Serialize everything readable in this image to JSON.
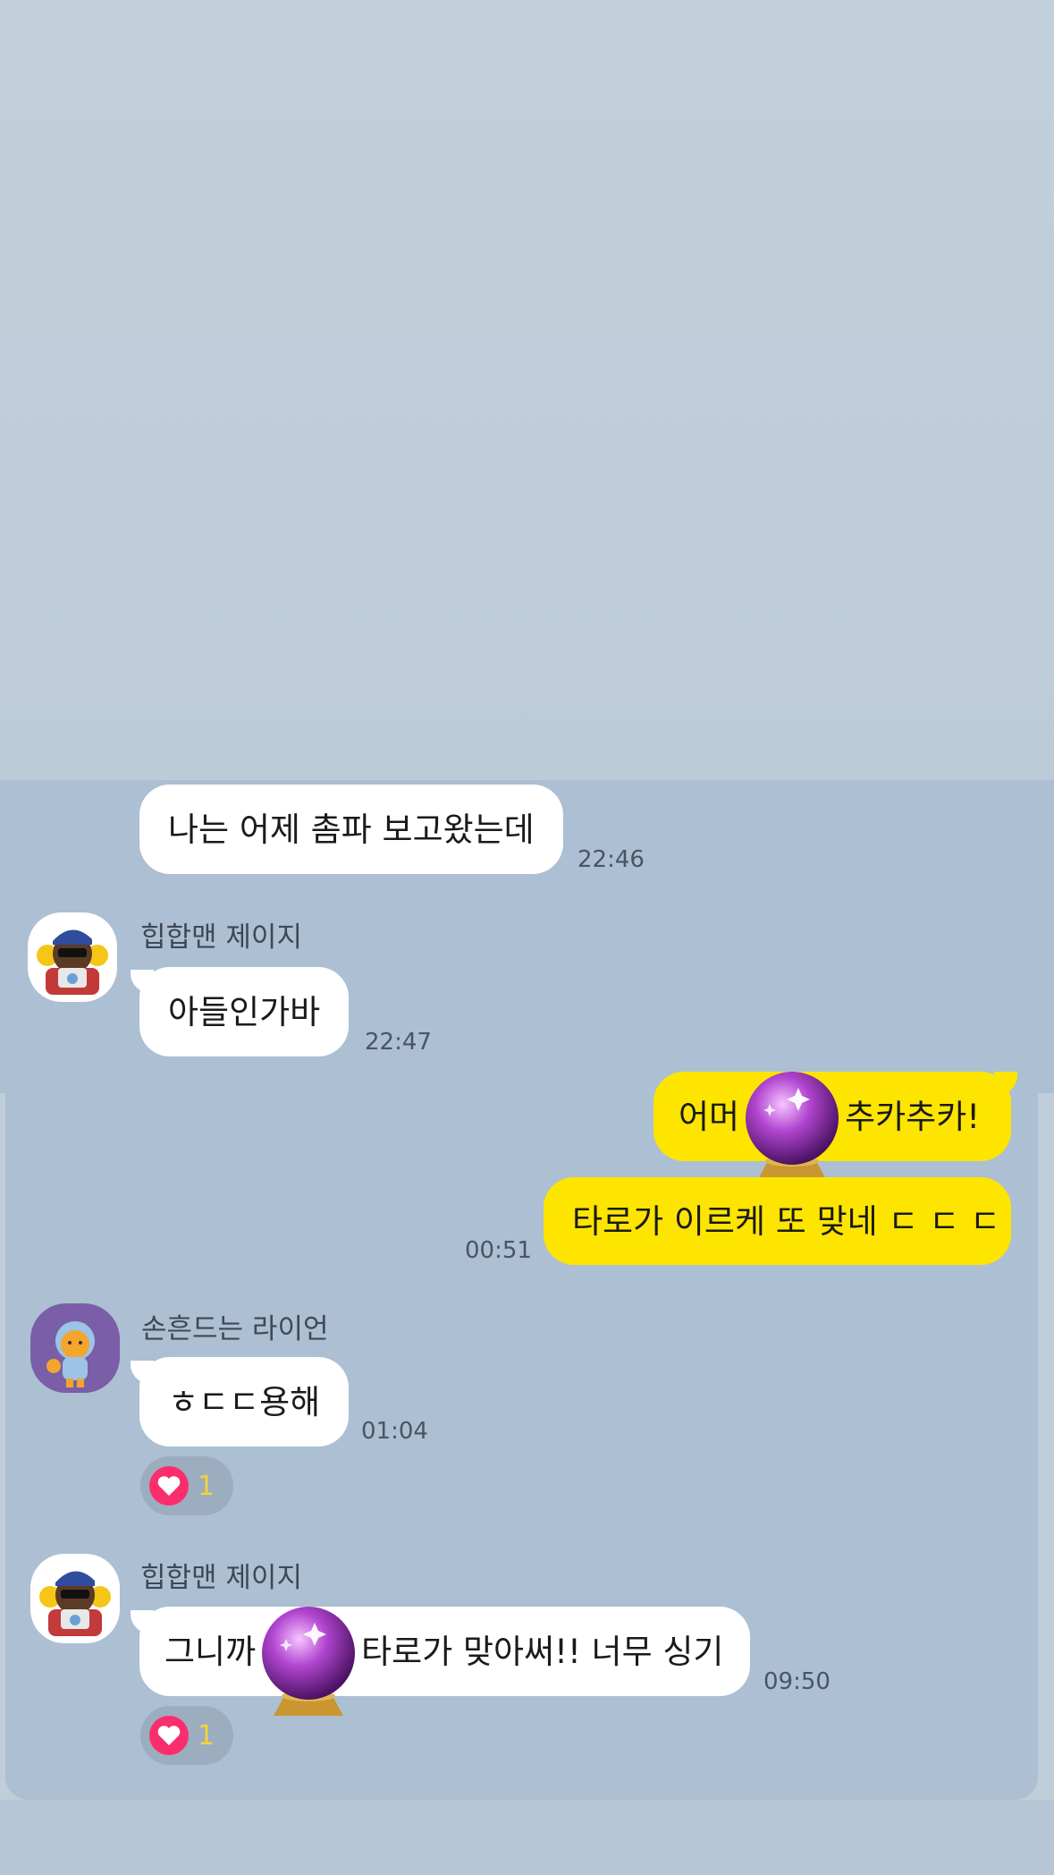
{
  "messages": [
    {
      "type": "in",
      "text": "나는 어제 촘파 보고왔는데",
      "time": "22:46"
    },
    {
      "type": "in",
      "sender": "힙합맨 제이지",
      "text": "아들인가바",
      "time": "22:47"
    },
    {
      "type": "out",
      "text_before": "어머",
      "text_after": "추카추카!",
      "sticker": "crystal-ball-emoji"
    },
    {
      "type": "out",
      "text": "타로가 이르케 또 맞네 ㄷ ㄷ ㄷ",
      "time": "00:51"
    },
    {
      "type": "in",
      "sender": "손흔드는 라이언",
      "text": "ㅎㄷㄷ용해",
      "time": "01:04",
      "reaction": {
        "icon": "heart-icon",
        "count": "1"
      }
    },
    {
      "type": "in",
      "sender": "힙합맨 제이지",
      "text_before": "그니까",
      "text_after": "타로가 맞아써!! 너무 싱기",
      "time": "09:50",
      "sticker": "crystal-ball-emoji",
      "reaction": {
        "icon": "heart-icon",
        "count": "1"
      }
    }
  ],
  "colors": {
    "chat_background": "#acbfd3",
    "outgoing_bubble": "#fee500",
    "incoming_bubble": "#ffffff",
    "reaction_heart": "#fb2e6d"
  }
}
